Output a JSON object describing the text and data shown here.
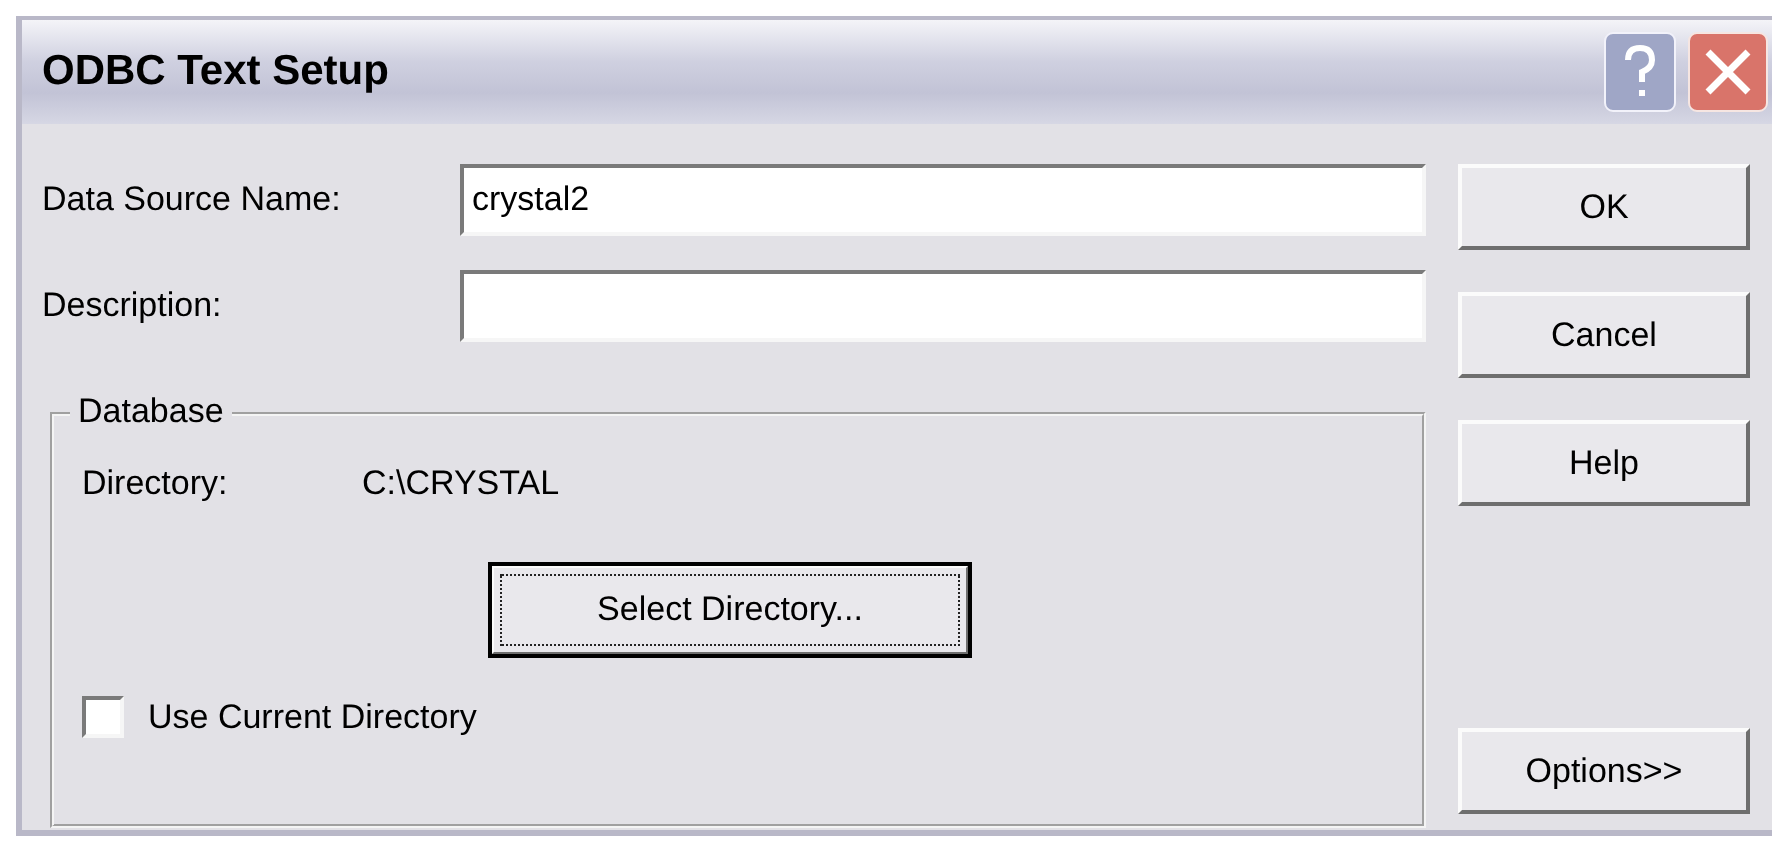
{
  "window": {
    "title": "ODBC Text Setup"
  },
  "fields": [
    {
      "label": "Data Source Name:",
      "value": "crystal2"
    },
    {
      "label": "Description:"
    }
  ],
  "database": {
    "legend": "Database",
    "directory_label": "Directory:",
    "directory": "C:\\CRYSTAL",
    "select_button": {
      "label": "Select Directory...",
      "focused": true
    },
    "use_current": {
      "label": "Use Current Directory",
      "checked": false
    }
  },
  "buttons": [
    {
      "label": "OK"
    },
    {
      "label": "Cancel"
    },
    {
      "label": "Help"
    },
    {
      "label": "Options>>"
    }
  ]
}
